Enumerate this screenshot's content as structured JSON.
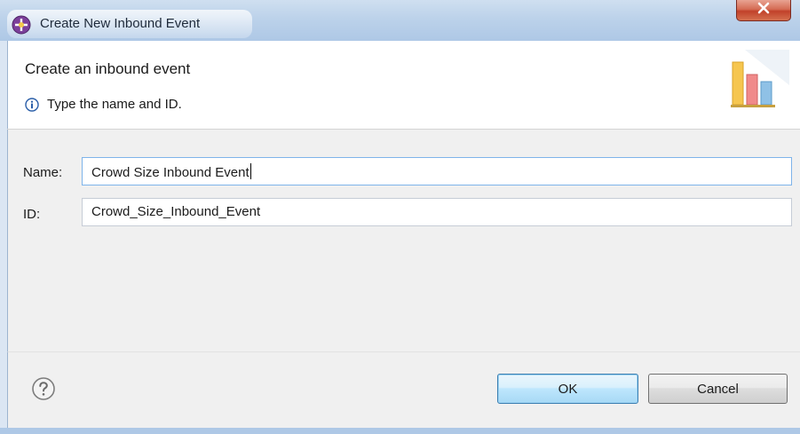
{
  "window": {
    "title": "Create New Inbound Event",
    "close_label": "X"
  },
  "header": {
    "title": "Create an inbound event",
    "message": "Type the name and ID."
  },
  "form": {
    "name_label": "Name:",
    "name_value": "Crowd Size Inbound Event",
    "id_label": "ID:",
    "id_value": "Crowd_Size_Inbound_Event"
  },
  "buttons": {
    "ok_label": "OK",
    "cancel_label": "Cancel"
  },
  "icons": {
    "app": "event-wizard-icon",
    "close": "close-icon",
    "info": "info-icon",
    "wizard_banner": "bar-chart-icon",
    "help": "help-icon"
  },
  "colors": {
    "title_bar": "#bcd2ea",
    "close_button": "#c1412a",
    "default_button_border": "#3c7fb1",
    "focused_input_border": "#7eb4ea"
  }
}
